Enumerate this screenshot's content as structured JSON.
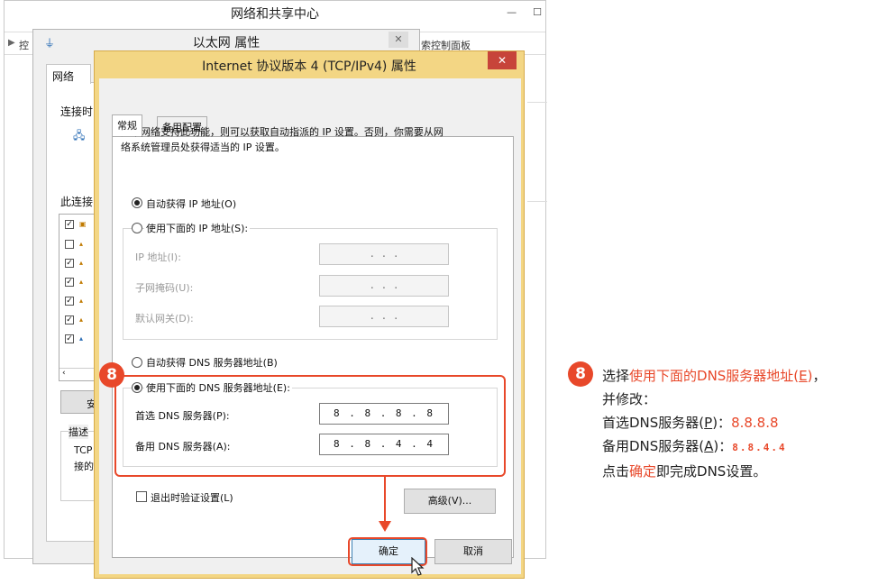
{
  "bg_window": {
    "title": "网络和共享中心",
    "breadcrumb": "控",
    "control_panel": "索控制面板"
  },
  "mid_window": {
    "title": "以太网 属性",
    "tab": "网络",
    "connect_label": "连接时",
    "items_label": "此连接",
    "button_partial": "安",
    "desc_label": "描述",
    "desc_text_1": "TCP",
    "desc_text_2": "接的"
  },
  "dialog": {
    "title": "Internet 协议版本 4 (TCP/IPv4) 属性",
    "close": "✕",
    "tabs": [
      "常规",
      "备用配置"
    ],
    "intro_line1": "如果网络支持此功能，则可以获取自动指派的 IP 设置。否则，你需要从网",
    "intro_line2": "络系统管理员处获得适当的 IP 设置。",
    "auto_ip": "自动获得 IP 地址(O)",
    "use_ip": "使用下面的 IP 地址(S):",
    "ip_address": "IP 地址(I):",
    "subnet": "子网掩码(U):",
    "gateway": "默认网关(D):",
    "empty_ip": ".   .   .",
    "auto_dns": "自动获得 DNS 服务器地址(B)",
    "use_dns": "使用下面的 DNS 服务器地址(E):",
    "preferred_dns_label": "首选 DNS 服务器(P):",
    "preferred_dns_value": "8 . 8 . 8 . 8",
    "alternate_dns_label": "备用 DNS 服务器(A):",
    "alternate_dns_value": "8 . 8 . 4 . 4",
    "validate_on_exit": "退出时验证设置(L)",
    "advanced": "高级(V)...",
    "ok": "确定",
    "cancel": "取消"
  },
  "step": {
    "number": "8",
    "line1_prefix": "选择",
    "line1_highlight": "使用下面的DNS服务器地址(",
    "line1_key": "E",
    "line1_close": ")",
    "line1_suffix": "，",
    "line2": "并修改：",
    "line3_prefix": "首选DNS服务器(",
    "line3_key": "P",
    "line3_close": ")：",
    "line3_value": "8.8.8.8",
    "line4_prefix": "备用DNS服务器(",
    "line4_key": "A",
    "line4_close": ")：",
    "line4_value": "8.8.4.4",
    "line5_prefix": "点击",
    "line5_highlight": "确定",
    "line5_suffix": "即完成DNS设置。"
  },
  "colors": {
    "accent": "#e8482a",
    "dialog_frame": "#f3d684",
    "close_red": "#c7443a"
  }
}
